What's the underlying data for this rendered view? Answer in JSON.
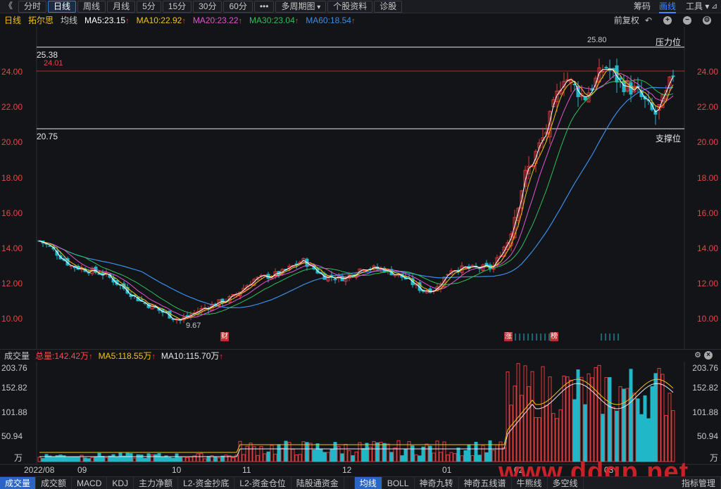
{
  "toolbar": {
    "collapse_icon": "《",
    "periods": [
      "分时",
      "日线",
      "周线",
      "月线",
      "5分",
      "15分",
      "30分",
      "60分"
    ],
    "more_icon": "•••",
    "multi_period": "多周期图",
    "stock_info": "个股资料",
    "diagnose": "诊股",
    "right": {
      "chips": "筹码",
      "draw_line": "画线",
      "tools": "工具"
    }
  },
  "main_header": {
    "period": "日线",
    "name": "拓尔思",
    "avg_label": "均线",
    "ma": [
      {
        "label": "MA5:23.15",
        "color": "#ffffff"
      },
      {
        "label": "MA10:22.92",
        "color": "#f2c318"
      },
      {
        "label": "MA20:23.22",
        "color": "#e055d0"
      },
      {
        "label": "MA30:23.04",
        "color": "#2fbf5a"
      },
      {
        "label": "MA60:18.54",
        "color": "#3a8ee6"
      }
    ],
    "adjust": "前复权"
  },
  "price_axis": [
    "24.00",
    "22.00",
    "20.00",
    "18.00",
    "16.00",
    "14.00",
    "12.00",
    "10.00"
  ],
  "annotations": {
    "pressure_value": "25.38",
    "current_value": "24.01",
    "support_value": "20.75",
    "pressure_label": "压力位",
    "support_label": "支撑位",
    "high_label": "25.80",
    "low_label": "9.67",
    "marks": [
      "财",
      "涨",
      "榜"
    ]
  },
  "vol_header": {
    "title": "成交量",
    "total": "总量:142.42万",
    "ma5": "MA5:118.55万",
    "ma10": "MA10:115.70万"
  },
  "vol_axis": [
    "203.76",
    "152.82",
    "101.88",
    "50.94",
    "万"
  ],
  "x_axis": [
    "2022/08",
    "09",
    "10",
    "11",
    "12",
    "01",
    "02",
    "03"
  ],
  "bottom_tabs": [
    "成交量",
    "成交额",
    "MACD",
    "KDJ",
    "主力净额",
    "L2-资金抄底",
    "L2-资金仓位",
    "陆股通资金",
    "均线",
    "BOLL",
    "神奇九转",
    "神奇五线谱",
    "牛熊线",
    "多空线",
    "指标管理"
  ],
  "watermark": "www.ddgp.net",
  "colors": {
    "up": "#e03a3a",
    "down": "#20b8c8",
    "ma5": "#ffffff",
    "ma10": "#f2c318",
    "ma20": "#e055d0",
    "ma30": "#2fbf5a",
    "ma60": "#3a8ee6"
  }
}
